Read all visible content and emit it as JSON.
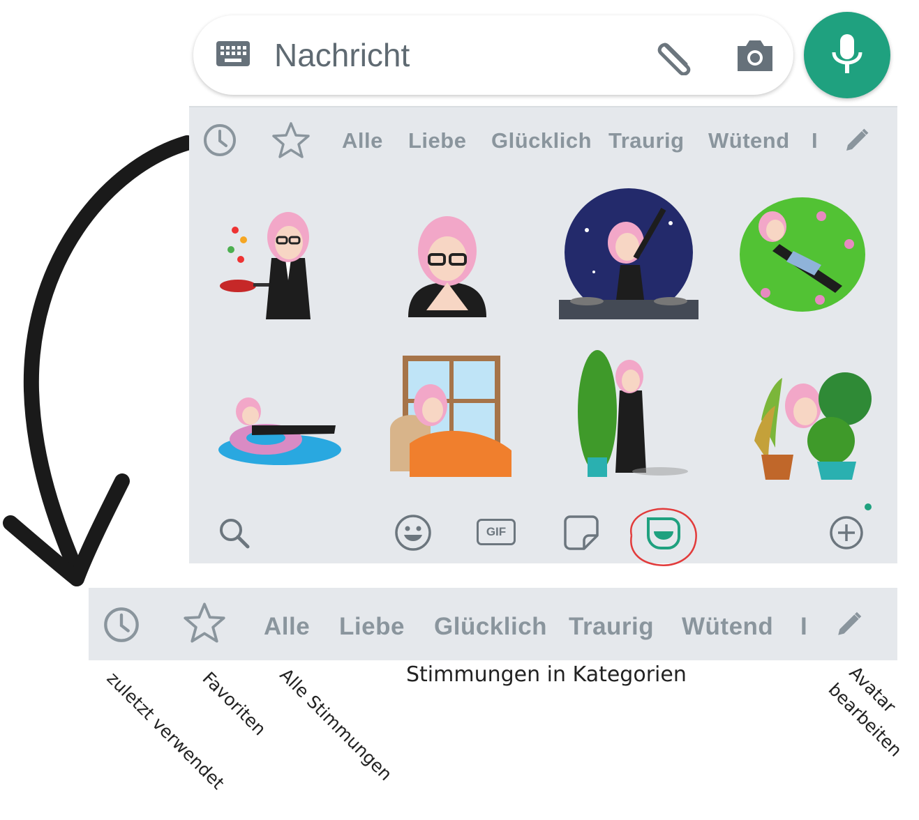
{
  "compose": {
    "placeholder": "Nachricht",
    "icons": [
      "keyboard-icon",
      "attach-icon",
      "camera-icon",
      "mic-icon"
    ]
  },
  "categories": {
    "items": [
      "Alle",
      "Liebe",
      "Glücklich",
      "Traurig",
      "Wütend",
      "I"
    ],
    "icons": [
      "clock-icon",
      "star-icon",
      "pencil-icon"
    ]
  },
  "stickers": [
    "avatar-cooking-sticker",
    "avatar-thinking-sticker",
    "avatar-dj-sticker",
    "avatar-lying-in-grass-sticker",
    "avatar-floating-sticker",
    "avatar-in-bed-sticker",
    "avatar-with-tree-sticker",
    "avatar-with-plants-sticker"
  ],
  "bottom_bar": {
    "icons": [
      "search-icon",
      "emoji-icon",
      "gif-icon",
      "sticker-icon",
      "avatar-icon",
      "add-icon"
    ],
    "gif_label": "GIF"
  },
  "strip": {
    "items": [
      "Alle",
      "Liebe",
      "Glücklich",
      "Traurig",
      "Wütend",
      "I"
    ]
  },
  "annotations": {
    "caption": "Stimmungen in Kategorien",
    "recent": "zuletzt verwendet",
    "favorites": "Favoriten",
    "all": "Alle Stimmungen",
    "edit_avatar_line1": "Avatar",
    "edit_avatar_line2": "bearbeiten"
  },
  "colors": {
    "accent": "#1fa17f",
    "panel_bg": "#e5e8ec",
    "icon_gray": "#8a959d",
    "highlight_circle": "#e23b3b"
  }
}
